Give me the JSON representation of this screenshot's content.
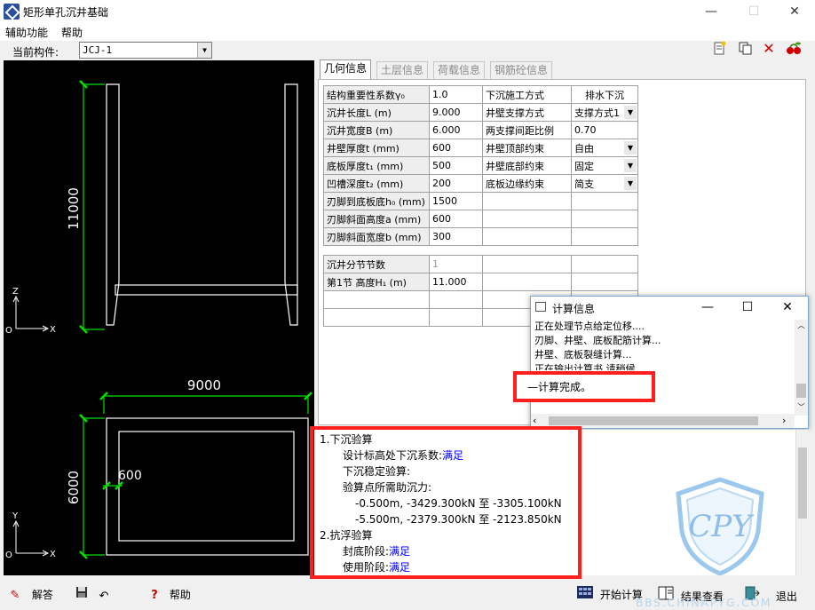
{
  "window": {
    "title": "矩形单孔沉井基础",
    "minimize": "—",
    "maximize": "☐",
    "close": "✕"
  },
  "menu": [
    "辅助功能",
    "帮助"
  ],
  "toolbar": {
    "component_label": "当前构件:",
    "component_value": "JCJ-1",
    "icons": [
      "new-doc-icon",
      "copy-icon",
      "delete-icon",
      "cherry-icon"
    ]
  },
  "drawing": {
    "height_dim": "11000",
    "width_dim": "9000",
    "plan_height_dim": "6000",
    "wall_dim": "600",
    "axis_z": "Z",
    "axis_x": "X",
    "axis_y": "Y",
    "origin": "O"
  },
  "tabs": [
    "几何信息",
    "土层信息",
    "荷载信息",
    "钢筋砼信息"
  ],
  "geometry_rows": [
    [
      "结构重要性系数γ₀",
      "1.0",
      "下沉施工方式",
      "排水下沉"
    ],
    [
      "沉井长度L (m)",
      "9.000",
      "井壁支撑方式",
      "支撑方式1"
    ],
    [
      "沉井宽度B (m)",
      "6.000",
      "两支撑间距比例",
      "0.70"
    ],
    [
      "井壁厚度t (mm)",
      "600",
      "井壁顶部约束",
      "自由"
    ],
    [
      "底板厚度t₁ (mm)",
      "500",
      "井壁底部约束",
      "固定"
    ],
    [
      "凹槽深度t₂ (mm)",
      "200",
      "底板边缘约束",
      "简支"
    ],
    [
      "刃脚到底板底h₀ (mm)",
      "1500",
      "",
      ""
    ],
    [
      "刃脚斜面高度a (mm)",
      "600",
      "",
      ""
    ],
    [
      "刃脚斜面宽度b (mm)",
      "300",
      "",
      ""
    ]
  ],
  "segment_rows": [
    [
      "沉井分节节数",
      "1",
      "",
      ""
    ],
    [
      "第1节   高度H₁ (m)",
      "11.000",
      "",
      ""
    ],
    [
      "",
      "",
      "",
      ""
    ],
    [
      "",
      "",
      "",
      ""
    ]
  ],
  "calc_window": {
    "title": "计算信息",
    "lines": [
      "正在处理节点给定位移....",
      "刃脚、井壁、底板配筋计算...",
      "井壁、底板裂缝计算...",
      "正在输出计算书,请稍候..."
    ],
    "done": "—计算完成。"
  },
  "results": {
    "h1": "1.下沉验算",
    "l1_label": "设计标高处下沉系数:",
    "l1_value": "满足",
    "l2": "下沉稳定验算:",
    "l3": "验算点所需助沉力:",
    "l4": "-0.500m, -3429.300kN 至 -3305.100kN",
    "l5": "-5.500m, -2379.300kN 至 -2123.850kN",
    "h2": "2.抗浮验算",
    "l6_label": "封底阶段:",
    "l6_value": "满足",
    "l7_label": "使用阶段:",
    "l7_value": "满足"
  },
  "bottom": {
    "answer": "解答",
    "help": "帮助",
    "start": "开始计算",
    "view": "结果查看",
    "exit": "退出"
  },
  "watermark": {
    "letters": "CPY",
    "site": "BBS.CHINAPYG.COM"
  },
  "colors": {
    "highlight": "#ff1f1f",
    "dim_line": "#00e000",
    "link": "#0000ff"
  }
}
